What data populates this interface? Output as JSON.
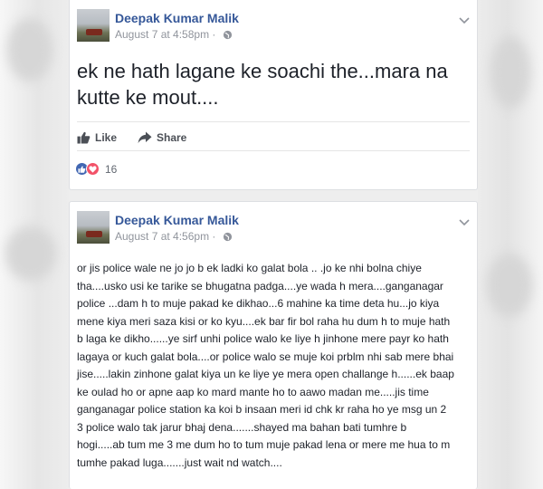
{
  "posts": [
    {
      "author": "Deepak Kumar Malik",
      "time": "August 7 at 4:58pm",
      "separator": "·",
      "text": "ek ne hath lagane ke soachi the...mara na kutte ke mout....",
      "actions": {
        "like": "Like",
        "share": "Share"
      },
      "reaction_count": "16"
    },
    {
      "author": "Deepak Kumar Malik",
      "time": "August 7 at 4:56pm",
      "separator": "·",
      "text": "or jis police wale ne jo jo b ek ladki ko galat bola .. .jo ke nhi bolna chiye\ntha....usko usi ke tarike se bhugatna padga....ye wada h mera....ganganagar\npolice ...dam h to muje pakad ke dikhao...6 mahine ka time deta hu...jo kiya\nmene kiya meri saza kisi or ko kyu....ek bar fir bol raha hu dum h to muje hath\nb laga ke dikho......ye sirf unhi police walo ke liye h jinhone mere payr ko hath\nlagaya or kuch galat bola....or police walo se muje koi prblm nhi sab mere bhai\njise.....lakin zinhone galat kiya un ke liye ye mera open challange h......ek baap\nke oulad ho or apne aap ko mard mante ho to aawo madan me.....jis time\nganganagar police station ka koi b insaan meri id chk kr raha ho ye msg un 2\n3 police walo tak jarur bhaj dena.......shayed ma bahan bati tumhre b\nhogi.....ab tum me 3 me dum ho to tum muje pakad lena or mere me hua to m\ntumhe pakad luga.......just wait nd watch...."
    }
  ],
  "icons": {
    "privacy": "globe-icon",
    "menu": "chevron-down-icon",
    "like": "thumbs-up-icon",
    "share": "share-arrow-icon",
    "reactions": [
      "like-reaction-icon",
      "love-reaction-icon"
    ]
  },
  "colors": {
    "name": "#365899",
    "meta": "#90949c",
    "like": "#4267b2",
    "love": "#f25268"
  }
}
